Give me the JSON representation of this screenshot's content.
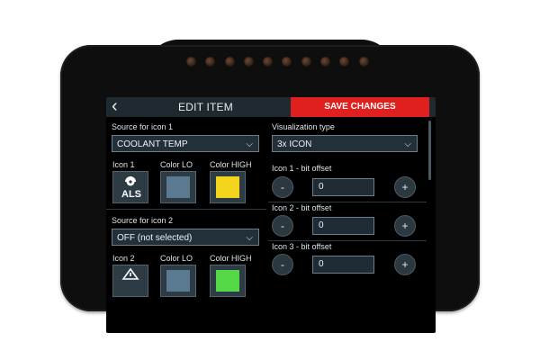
{
  "header": {
    "back_glyph": "‹",
    "title": "EDIT ITEM",
    "save_label": "SAVE CHANGES"
  },
  "left": {
    "source1_label": "Source for icon 1",
    "source1_value": "COOLANT TEMP",
    "icon1_label": "Icon 1",
    "color_lo_label": "Color LO",
    "color_high_label": "Color HIGH",
    "icon1_name": "ALS",
    "icon1_color_lo": "#5a7a92",
    "icon1_color_high": "#f4d31c",
    "source2_label": "Source for icon 2",
    "source2_value": "OFF (not selected)",
    "icon2_label": "Icon 2",
    "color_lo2_label": "Color LO",
    "color_high2_label": "Color HIGH",
    "icon2_color_lo": "#5a7a92",
    "icon2_color_high": "#55d845"
  },
  "right": {
    "viz_label": "Visualization type",
    "viz_value": "3x ICON",
    "offsets": [
      {
        "label": "Icon 1 - bit offset",
        "value": "0"
      },
      {
        "label": "Icon 2 - bit offset",
        "value": "0"
      },
      {
        "label": "Icon 3 - bit offset",
        "value": "0"
      }
    ],
    "minus_glyph": "-",
    "plus_glyph": "+"
  },
  "colors": {
    "accent": "#e01f1f",
    "panel": "#22303a"
  }
}
